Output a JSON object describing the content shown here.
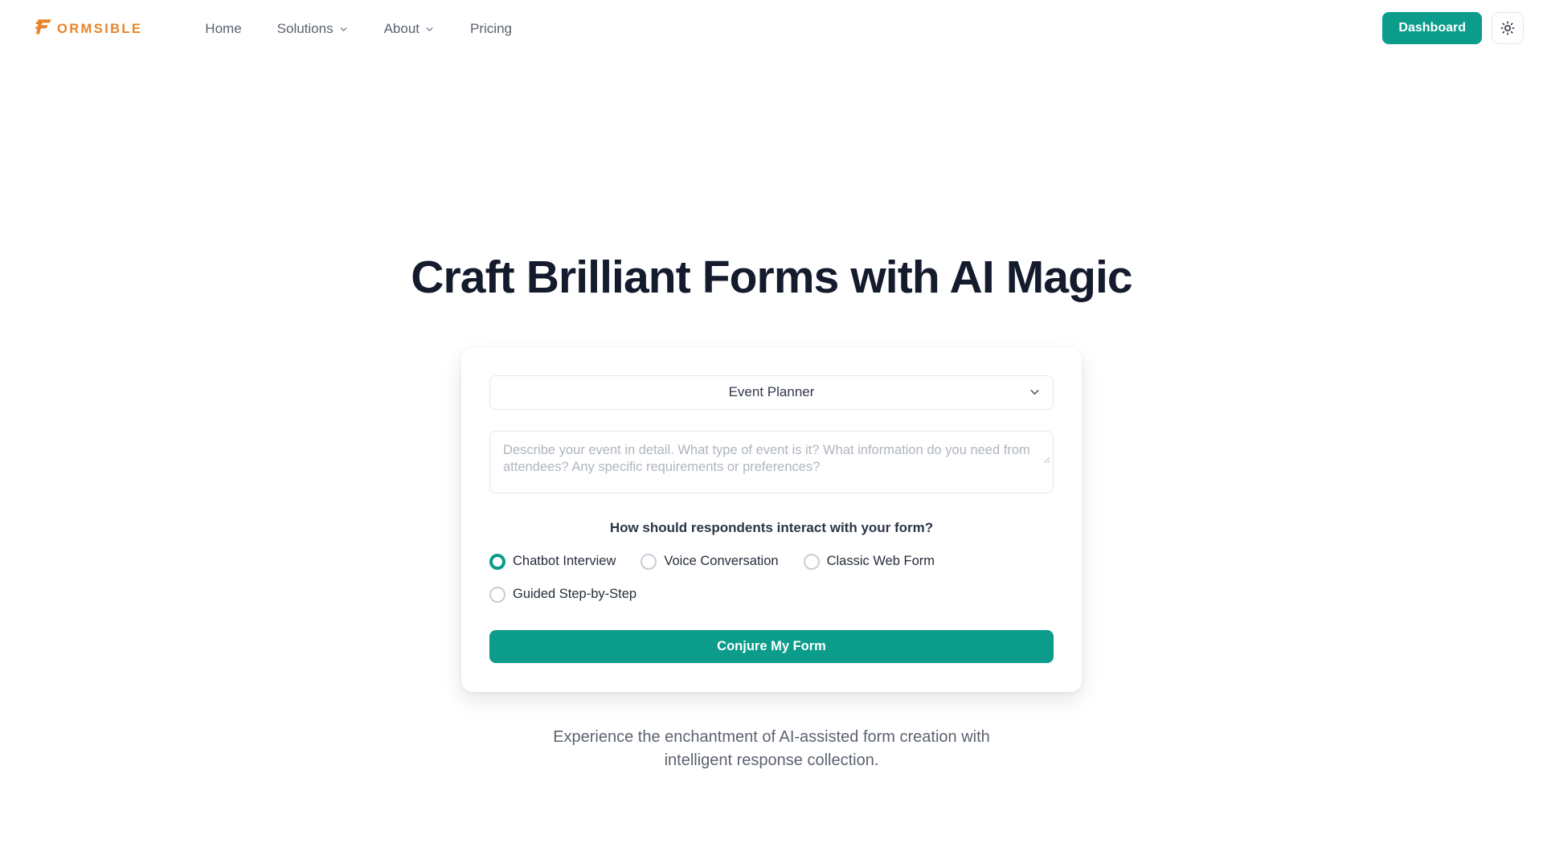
{
  "header": {
    "logo": {
      "mark_icon": "formsible-f-logo-icon",
      "text": "ORMSIBLE",
      "color": "#E8842A"
    },
    "nav": [
      {
        "label": "Home",
        "has_chevron": false,
        "icon": ""
      },
      {
        "label": "Solutions",
        "has_chevron": true,
        "icon": "chevron-down-icon"
      },
      {
        "label": "About",
        "has_chevron": true,
        "icon": "chevron-down-icon"
      },
      {
        "label": "Pricing",
        "has_chevron": false,
        "icon": ""
      }
    ],
    "dashboard_label": "Dashboard",
    "theme_toggle_icon": "sun-icon"
  },
  "hero": {
    "title": "Craft Brilliant Forms with AI Magic",
    "subtitle": "Experience the enchantment of AI-assisted form creation with intelligent response collection."
  },
  "form": {
    "template_select": {
      "selected": "Event Planner",
      "chevron_icon": "chevron-down-icon",
      "options": [
        "Event Planner"
      ]
    },
    "description": {
      "value": "",
      "placeholder": "Describe your event in detail. What type of event is it? What information do you need from attendees? Any specific requirements or preferences?",
      "resize_icon": "resize-handle-icon"
    },
    "interaction_question": "How should respondents interact with your form?",
    "interaction_options": [
      {
        "label": "Chatbot Interview",
        "selected": true
      },
      {
        "label": "Voice Conversation",
        "selected": false
      },
      {
        "label": "Classic Web Form",
        "selected": false
      },
      {
        "label": "Guided Step-by-Step",
        "selected": false
      }
    ],
    "submit_label": "Conjure My Form"
  },
  "colors": {
    "accent_teal": "#0B9C8B",
    "brand_orange": "#E8842A",
    "heading_navy": "#141B2D",
    "body_gray": "#5C636F"
  }
}
